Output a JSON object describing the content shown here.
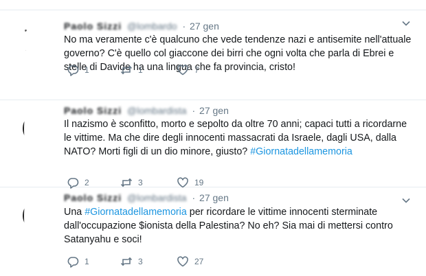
{
  "tweets": [
    {
      "name": "Paolo Sizzi",
      "handle": "@lombardo",
      "date": "27 gen",
      "text": "No ma veramente c'è qualcuno che vede tendenze nazi e antisemite nell'attuale governo? C'è quello col giaccone dei birri che ogni volta che parla di Ebrei e stelle di Davide ha una lingua che fa provincia, cristo!",
      "replies": "1",
      "retweets": "1",
      "likes": "7"
    },
    {
      "name": "Paolo Sizzi",
      "handle": "@lombardista",
      "date": "27 gen",
      "text_before": "Il nazismo è sconfitto, morto e sepolto da oltre 70 anni; capaci tutti a ricordarne le vittime. Ma che dire degli innocenti massacrati da Israele, dagli USA, dalla NATO? Morti figli di un dio minore, giusto? ",
      "hashtag": "#Giornatadellamemoria",
      "replies": "2",
      "retweets": "3",
      "likes": "19"
    },
    {
      "name": "Paolo Sizzi",
      "handle": "@lombardista",
      "date": "27 gen",
      "text_before": "Una ",
      "hashtag": "#Giornatadellamemoria",
      "text_after": " per ricordare le vittime innocenti sterminate dall'occupazione $ionista della Palestina? No eh? Sia mai di mettersi contro Satanyahu e soci!",
      "replies": "1",
      "retweets": "3",
      "likes": "27"
    }
  ],
  "icons": {
    "reply": "reply-icon",
    "retweet": "retweet-icon",
    "like": "heart-icon",
    "menu": "chevron-down-icon"
  },
  "colors": {
    "link": "#1b95e0",
    "muted": "#657786",
    "divider": "#e6ecf0"
  }
}
